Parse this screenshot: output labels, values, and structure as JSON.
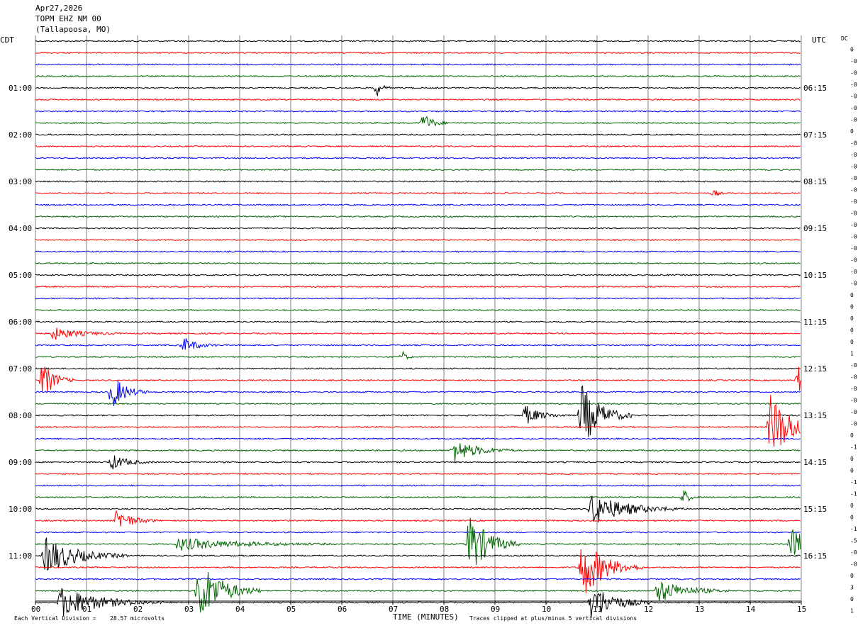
{
  "header": {
    "date": "Apr27,2026",
    "station": "TOPM EHZ NM 00",
    "location": "(Tallapoosa, MO)"
  },
  "left_tz": "CDT",
  "right_tz": "UTC",
  "dc_label": "DC",
  "footer": {
    "scale_prefix": "Each Vertical Division =",
    "scale_value": "28.57 microvolts",
    "clip_note": "Traces clipped at plus/minus 5 vertical divisions"
  },
  "colors": {
    "black": "#000000",
    "red": "#ff0000",
    "blue": "#0000ff",
    "green": "#006400",
    "grid": "#808080"
  },
  "chart_data": {
    "type": "line",
    "xlabel": "TIME (MINUTES)",
    "xlim": [
      0,
      15
    ],
    "x_ticks": [
      "00",
      "01",
      "02",
      "03",
      "04",
      "05",
      "06",
      "07",
      "08",
      "09",
      "10",
      "11",
      "12",
      "13",
      "14",
      "15"
    ],
    "left_hour_labels": [
      "01:00",
      "02:00",
      "03:00",
      "04:00",
      "05:00",
      "06:00",
      "07:00",
      "08:00",
      "09:00",
      "10:00",
      "11:00"
    ],
    "right_hour_labels": [
      "06:15",
      "07:15",
      "08:15",
      "09:15",
      "10:15",
      "11:15",
      "12:15",
      "13:15",
      "14:15",
      "15:15",
      "16:15"
    ],
    "trace_colors": [
      "black",
      "red",
      "blue",
      "green"
    ],
    "trace_count": 48,
    "dc_offsets": [
      "0",
      "-0",
      "-0",
      "-0",
      "-0",
      "-0",
      "-0",
      "0",
      "-0",
      "-0",
      "-0",
      "-0",
      "-0",
      "-0",
      "-0",
      "-0",
      "-0",
      "-0",
      "-0",
      "-0",
      "-0",
      "0",
      "0",
      "0",
      "0",
      "0",
      "1",
      "-0",
      "-0",
      "-0",
      "-0",
      "-0",
      "-0",
      "0",
      "-1",
      "0",
      "0",
      "-1",
      "-1",
      "0",
      "0",
      "-1",
      "-5",
      "-0",
      "-0",
      "0",
      "3",
      "0",
      "1"
    ],
    "events": [
      {
        "trace": 4,
        "minute": 6.7,
        "amp": 1.2,
        "dur": 0.25
      },
      {
        "trace": 7,
        "minute": 7.6,
        "amp": 1.5,
        "dur": 0.5
      },
      {
        "trace": 13,
        "minute": 13.3,
        "amp": 0.6,
        "dur": 0.2
      },
      {
        "trace": 25,
        "minute": 0.35,
        "amp": 1.0,
        "dur": 1.3
      },
      {
        "trace": 26,
        "minute": 2.9,
        "amp": 1.2,
        "dur": 0.7
      },
      {
        "trace": 27,
        "minute": 7.2,
        "amp": 0.8,
        "dur": 0.2
      },
      {
        "trace": 29,
        "minute": 0.15,
        "amp": 3.0,
        "dur": 0.6
      },
      {
        "trace": 30,
        "minute": 1.5,
        "amp": 2.8,
        "dur": 0.7
      },
      {
        "trace": 29,
        "minute": 14.95,
        "amp": 2.2,
        "dur": 0.3
      },
      {
        "trace": 32,
        "minute": 10.7,
        "amp": 5.0,
        "dur": 1.0
      },
      {
        "trace": 32,
        "minute": 9.6,
        "amp": 1.5,
        "dur": 0.8
      },
      {
        "trace": 33,
        "minute": 14.4,
        "amp": 5.0,
        "dur": 1.3
      },
      {
        "trace": 35,
        "minute": 8.2,
        "amp": 1.8,
        "dur": 1.2
      },
      {
        "trace": 36,
        "minute": 1.5,
        "amp": 1.2,
        "dur": 0.8
      },
      {
        "trace": 39,
        "minute": 12.7,
        "amp": 1.2,
        "dur": 0.3
      },
      {
        "trace": 40,
        "minute": 10.9,
        "amp": 2.5,
        "dur": 1.8
      },
      {
        "trace": 41,
        "minute": 1.6,
        "amp": 1.8,
        "dur": 0.8
      },
      {
        "trace": 43,
        "minute": 8.5,
        "amp": 5.0,
        "dur": 1.0
      },
      {
        "trace": 43,
        "minute": 14.8,
        "amp": 2.5,
        "dur": 1.0
      },
      {
        "trace": 43,
        "minute": 2.8,
        "amp": 1.0,
        "dur": 3.0
      },
      {
        "trace": 44,
        "minute": 0.2,
        "amp": 3.0,
        "dur": 1.6
      },
      {
        "trace": 45,
        "minute": 10.7,
        "amp": 5.0,
        "dur": 1.2
      },
      {
        "trace": 47,
        "minute": 3.2,
        "amp": 5.0,
        "dur": 1.2
      },
      {
        "trace": 47,
        "minute": 12.2,
        "amp": 1.8,
        "dur": 1.4
      },
      {
        "trace": 48,
        "minute": 0.5,
        "amp": 2.5,
        "dur": 2.0
      },
      {
        "trace": 48,
        "minute": 10.9,
        "amp": 3.0,
        "dur": 1.2
      },
      {
        "trace": 49,
        "minute": 2.6,
        "amp": 5.0,
        "dur": 1.6
      },
      {
        "trace": 49,
        "minute": 11.4,
        "amp": 2.0,
        "dur": 1.4
      },
      {
        "trace": 50,
        "minute": 3.6,
        "amp": 5.0,
        "dur": 1.4
      },
      {
        "trace": 50,
        "minute": 0.5,
        "amp": 2.0,
        "dur": 1.6
      }
    ]
  }
}
